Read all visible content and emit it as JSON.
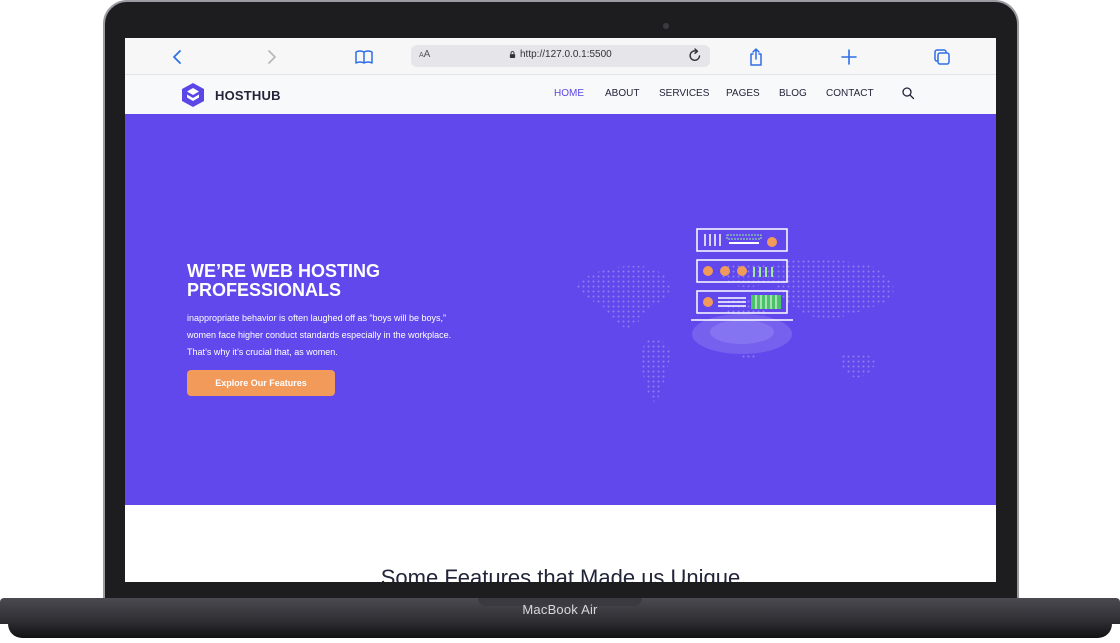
{
  "device": {
    "label": "MacBook Air"
  },
  "browser": {
    "url": "http://127.0.0.1:5500",
    "text_size_label": "AA",
    "icons": [
      "back-icon",
      "forward-icon",
      "bookmarks-icon",
      "lock-icon",
      "reload-icon",
      "share-icon",
      "new-tab-icon",
      "tabs-icon"
    ]
  },
  "site": {
    "brand": "HOSTHUB",
    "nav": [
      "HOME",
      "ABOUT",
      "SERVICES",
      "PAGES",
      "BLOG",
      "CONTACT"
    ],
    "active_nav": "HOME",
    "hero": {
      "title": "WE’RE WEB HOSTING PROFESSIONALS",
      "text": "inappropriate behavior is often laughed off as “boys will be boys,” women face higher conduct standards especially in the workplace. That’s why it’s crucial that, as women.",
      "cta": "Explore Our Features"
    },
    "features_title": "Some Features that Made us Unique"
  },
  "colors": {
    "primary": "#6148ec",
    "accent": "#f29a5a",
    "nav_text": "#22253a",
    "browser_blue": "#2f6fe6"
  }
}
